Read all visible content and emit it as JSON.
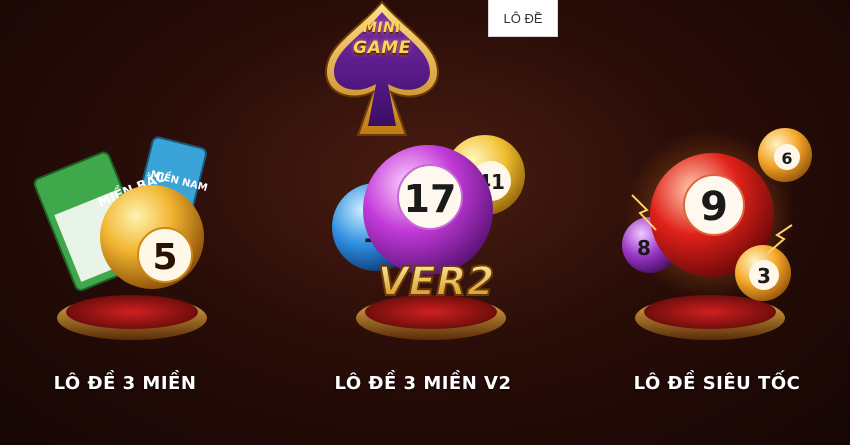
{
  "header": {
    "tab_label": "LÔ ĐỀ",
    "logo": {
      "line1": "MINI",
      "line2": "GAME"
    }
  },
  "games": [
    {
      "title": "LÔ ĐỀ 3 MIỀN",
      "ticket1": "MIỀN BẮC",
      "ticket2": "MIỀN NAM",
      "ball": "5"
    },
    {
      "title": "LÔ ĐỀ 3 MIỀN V2",
      "ball_main": "17",
      "ball_small": "41",
      "ball_left": "1",
      "badge": "VER2"
    },
    {
      "title": "LÔ ĐỀ SIÊU TỐC",
      "ball_main": "9",
      "ball_small_top": "6",
      "ball_small_bottom": "3",
      "ball_left": "8"
    }
  ],
  "colors": {
    "background": "#2a0d08",
    "gold": "#ffd45a",
    "purple": "#a531d6",
    "red": "#e0211a"
  }
}
